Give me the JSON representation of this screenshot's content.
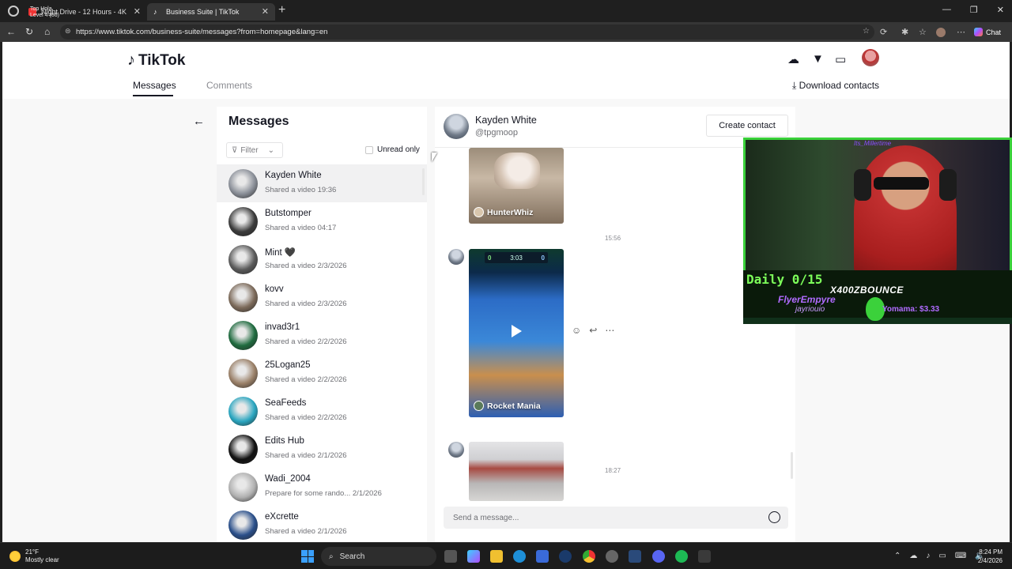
{
  "browser": {
    "tabs": [
      {
        "label": "Night Drive - 12 Hours - 4K",
        "overlay_text": [
          "Top Hola",
          "Level 4 (86)"
        ]
      },
      {
        "label": "Business Suite | TikTok"
      }
    ],
    "url": "https://www.tiktok.com/business-suite/messages?from=homepage&lang=en",
    "chat_label": "Chat"
  },
  "header": {
    "logo": "TikTok",
    "tabs": {
      "messages": "Messages",
      "comments": "Comments"
    },
    "download": "Download contacts"
  },
  "sidebar": {
    "title": "Messages",
    "filter": "Filter",
    "unread_only": "Unread only",
    "conversations": [
      {
        "name": "Kayden White",
        "preview": "Shared a video",
        "date": "19:36",
        "avatar_color": "#8a8f98"
      },
      {
        "name": "Butstomper",
        "preview": "Shared a video",
        "date": "04:17",
        "avatar_color": "#3b3b3b"
      },
      {
        "name": "Mint 🖤",
        "preview": "Shared a video",
        "date": "2/3/2026",
        "avatar_color": "#5a5a5a"
      },
      {
        "name": "kovv",
        "preview": "Shared a video",
        "date": "2/3/2026",
        "avatar_color": "#7c6a5a"
      },
      {
        "name": "invad3r1",
        "preview": "Shared a video",
        "date": "2/2/2026",
        "avatar_color": "#1f6b3f"
      },
      {
        "name": "25Logan25",
        "preview": "Shared a video",
        "date": "2/2/2026",
        "avatar_color": "#9a8068"
      },
      {
        "name": "SeaFeeds",
        "preview": "Shared a video",
        "date": "2/2/2026",
        "avatar_color": "#2aa6c0"
      },
      {
        "name": "Edits Hub",
        "preview": "Shared a video",
        "date": "2/1/2026",
        "avatar_color": "#111111"
      },
      {
        "name": "Wadi_2004",
        "preview": "Prepare for some rando...",
        "date": "2/1/2026",
        "avatar_color": "#b0b0b0"
      },
      {
        "name": "eXcrette",
        "preview": "Shared a video",
        "date": "2/1/2026",
        "avatar_color": "#2a4f8a"
      }
    ]
  },
  "chat": {
    "name": "Kayden White",
    "handle": "@tpgmoop",
    "create_contact": "Create contact",
    "messages": [
      {
        "label": "HunterWhiz"
      },
      {
        "time": "15:56",
        "label": "Rocket Mania",
        "score_left": "0",
        "score_time": "3:03",
        "score_right": "0"
      },
      {
        "time": "18:27"
      }
    ],
    "composer_placeholder": "Send a message..."
  },
  "stream_overlay": {
    "daily": "Daily 0/15",
    "streamer": "X400ZBOUNCE",
    "follower": "FlyerEmpyre",
    "tipper": "jayriouio",
    "tip": "Yomama: $3.33",
    "top_tag": "Its_Millertime"
  },
  "taskbar": {
    "weather_temp": "21°F",
    "weather_desc": "Mostly clear",
    "search": "Search",
    "time": "8:24 PM",
    "date": "2/4/2026"
  }
}
